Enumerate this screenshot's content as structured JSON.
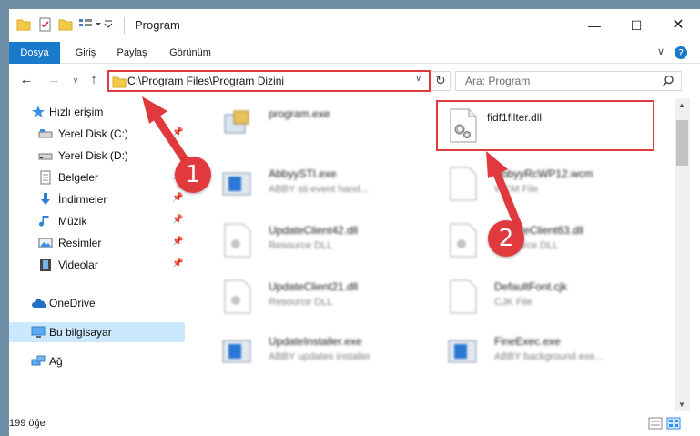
{
  "window": {
    "title": "Program",
    "controls": [
      "minimize-icon",
      "maximize-icon",
      "close-icon"
    ]
  },
  "ribbon": {
    "tabs": [
      "Dosya",
      "Giriş",
      "Paylaş",
      "Görünüm"
    ],
    "active_tab": "Dosya",
    "active_color": "#1979ca"
  },
  "nav": {
    "address": "C:\\Program Files\\Program Dizini",
    "search_placeholder": "Ara: Program"
  },
  "sidebar": {
    "items": [
      {
        "label": "Hızlı erişim",
        "icon": "star-icon"
      },
      {
        "label": "Yerel Disk (C:)",
        "icon": "drive-icon"
      },
      {
        "label": "Yerel Disk (D:)",
        "icon": "drive-icon"
      },
      {
        "label": "Belgeler",
        "icon": "documents-icon"
      },
      {
        "label": "İndirmeler",
        "icon": "download-icon"
      },
      {
        "label": "Müzik",
        "icon": "music-icon"
      },
      {
        "label": "Resimler",
        "icon": "pictures-icon"
      },
      {
        "label": "Videolar",
        "icon": "videos-icon"
      },
      {
        "label": "OneDrive",
        "icon": "cloud-icon"
      },
      {
        "label": "Bu bilgisayar",
        "icon": "computer-icon"
      },
      {
        "label": "Ağ",
        "icon": "network-icon"
      }
    ],
    "selected": "Bu bilgisayar"
  },
  "files": [
    {
      "name": "program.exe",
      "type": ""
    },
    {
      "name": "fidf1filter.dll",
      "type": ""
    },
    {
      "name": "AbbyySTI.exe",
      "type": "ABBY sti event hand..."
    },
    {
      "name": "AbbyyRcWP12.wcm",
      "type": "WCM File"
    },
    {
      "name": "UpdateClient42.dll",
      "type": "Resource DLL"
    },
    {
      "name": "UpdateClient63.dll",
      "type": "Resource DLL"
    },
    {
      "name": "UpdateClient21.dll",
      "type": "Resource DLL"
    },
    {
      "name": "DefaultFont.cjk",
      "type": "CJK File"
    },
    {
      "name": "UpdateInstaller.exe",
      "type": "ABBY updates installer"
    },
    {
      "name": "FineExec.exe",
      "type": "ABBY background exe..."
    }
  ],
  "status": {
    "item_count": "199 öğe"
  },
  "callouts": [
    {
      "number": "1",
      "color": "#e03a3e"
    },
    {
      "number": "2",
      "color": "#e03a3e"
    }
  ]
}
